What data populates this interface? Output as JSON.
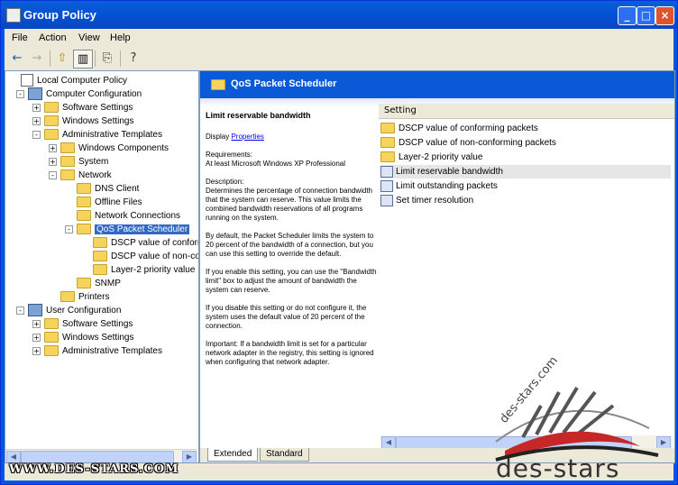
{
  "window": {
    "title": "Group Policy"
  },
  "menu": [
    "File",
    "Action",
    "View",
    "Help"
  ],
  "tree": [
    {
      "label": "Local Computer Policy",
      "level": 0,
      "icon": "policy-icon",
      "expander": ""
    },
    {
      "label": "Computer Configuration",
      "level": 1,
      "icon": "computer-icon",
      "expander": "-"
    },
    {
      "label": "Software Settings",
      "level": 2,
      "icon": "folder-icon",
      "expander": "+"
    },
    {
      "label": "Windows Settings",
      "level": 2,
      "icon": "folder-icon",
      "expander": "+"
    },
    {
      "label": "Administrative Templates",
      "level": 2,
      "icon": "folder-icon",
      "expander": "-"
    },
    {
      "label": "Windows Components",
      "level": 3,
      "icon": "folder-icon",
      "expander": "+"
    },
    {
      "label": "System",
      "level": 3,
      "icon": "folder-icon",
      "expander": "+"
    },
    {
      "label": "Network",
      "level": 3,
      "icon": "folder-icon",
      "expander": "-"
    },
    {
      "label": "DNS Client",
      "level": 4,
      "icon": "folder-icon",
      "expander": ""
    },
    {
      "label": "Offline Files",
      "level": 4,
      "icon": "folder-icon",
      "expander": ""
    },
    {
      "label": "Network Connections",
      "level": 4,
      "icon": "folder-icon",
      "expander": ""
    },
    {
      "label": "QoS Packet Scheduler",
      "level": 4,
      "icon": "folder-open-icon",
      "expander": "-",
      "selected": true
    },
    {
      "label": "DSCP value of conform",
      "level": 5,
      "icon": "folder-icon",
      "expander": ""
    },
    {
      "label": "DSCP value of non-con",
      "level": 5,
      "icon": "folder-icon",
      "expander": ""
    },
    {
      "label": "Layer-2 priority value",
      "level": 5,
      "icon": "folder-icon",
      "expander": ""
    },
    {
      "label": "SNMP",
      "level": 4,
      "icon": "folder-icon",
      "expander": ""
    },
    {
      "label": "Printers",
      "level": 3,
      "icon": "folder-icon",
      "expander": ""
    },
    {
      "label": "User Configuration",
      "level": 1,
      "icon": "user-icon",
      "expander": "-"
    },
    {
      "label": "Software Settings",
      "level": 2,
      "icon": "folder-icon",
      "expander": "+"
    },
    {
      "label": "Windows Settings",
      "level": 2,
      "icon": "folder-icon",
      "expander": "+"
    },
    {
      "label": "Administrative Templates",
      "level": 2,
      "icon": "folder-icon",
      "expander": "+"
    }
  ],
  "panel": {
    "header": "QoS Packet Scheduler",
    "setting_title": "Limit reservable bandwidth",
    "display_label": "Display",
    "properties_link": "Properties",
    "requirements": "Requirements:\nAt least Microsoft Windows XP Professional",
    "description": "Description:\nDetermines the percentage of connection bandwidth that the system can reserve. This value limits the combined bandwidth reservations of all programs running on the system.",
    "para1": "By default, the Packet Scheduler limits the system to 20 percent of the bandwidth of a connection, but you can use this setting to override the default.",
    "para2": "If you enable this setting, you can use the \"Bandwidth limit\" box to adjust the amount of bandwidth the system can reserve.",
    "para3": "If you disable this setting or do not configure it, the system uses the default value of 20 percent of the connection.",
    "para4": "Important: If a bandwidth limit is set for a particular network adapter in the registry, this setting is ignored when configuring that network adapter."
  },
  "list": {
    "column": "Setting",
    "items": [
      {
        "label": "DSCP value of conforming packets",
        "icon": "folder-icon"
      },
      {
        "label": "DSCP value of non-conforming packets",
        "icon": "folder-icon"
      },
      {
        "label": "Layer-2 priority value",
        "icon": "folder-icon"
      },
      {
        "label": "Limit reservable bandwidth",
        "icon": "setting-icon",
        "highlight": true
      },
      {
        "label": "Limit outstanding packets",
        "icon": "setting-icon"
      },
      {
        "label": "Set timer resolution",
        "icon": "setting-icon"
      }
    ]
  },
  "tabs": [
    "Extended",
    "Standard"
  ],
  "watermark": {
    "url": "WWW.DES-STARS.COM",
    "logo": "des-stars",
    "logo_arc": "des-stars.com"
  }
}
